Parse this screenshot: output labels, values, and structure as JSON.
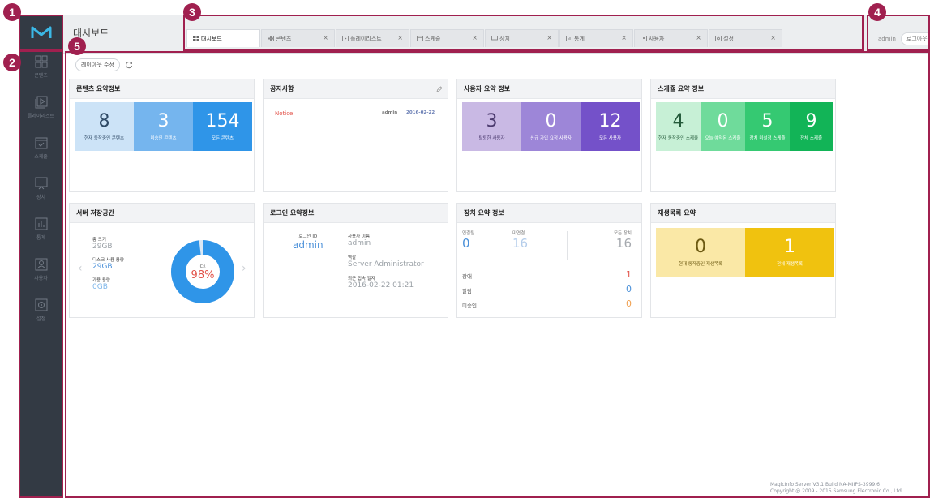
{
  "colors": {
    "sidebar_bg": "#333a44",
    "accent": "#a0204f",
    "blue": "#4a90d9",
    "red": "#e2534a",
    "orange": "#f0a050"
  },
  "badges": [
    "1",
    "2",
    "3",
    "4",
    "5"
  ],
  "sidebar": {
    "logo_icon": "magicinfo-logo-icon",
    "items": [
      {
        "label": "콘텐츠",
        "icon": "content-grid-icon"
      },
      {
        "label": "플레이리스트",
        "icon": "playlist-icon"
      },
      {
        "label": "스케쥴",
        "icon": "schedule-calendar-icon"
      },
      {
        "label": "장치",
        "icon": "device-monitor-icon"
      },
      {
        "label": "통계",
        "icon": "statistics-chart-icon"
      },
      {
        "label": "사용자",
        "icon": "user-icon"
      },
      {
        "label": "설정",
        "icon": "settings-gear-icon"
      }
    ]
  },
  "header": {
    "page_title": "대시보드",
    "tabs": [
      {
        "label": "대시보드",
        "active": true
      },
      {
        "label": "콘텐츠",
        "active": false
      },
      {
        "label": "플레이리스트",
        "active": false
      },
      {
        "label": "스케쥴",
        "active": false
      },
      {
        "label": "장치",
        "active": false
      },
      {
        "label": "통계",
        "active": false
      },
      {
        "label": "사용자",
        "active": false
      },
      {
        "label": "설정",
        "active": false
      }
    ],
    "tab_close": "×",
    "user": "admin",
    "logout": "로그아웃"
  },
  "toolbar": {
    "layout_edit": "레이아웃 수정"
  },
  "widgets": {
    "content": {
      "title": "콘텐츠 요약정보",
      "stats": [
        {
          "value": "8",
          "label": "현재 동작중인 콘텐츠"
        },
        {
          "value": "3",
          "label": "미승인 콘텐츠"
        },
        {
          "value": "154",
          "label": "모든 콘텐츠"
        }
      ]
    },
    "notice": {
      "title": "공지사항",
      "item_title": "Notice",
      "item_author": "admin",
      "item_date": "2016-02-22"
    },
    "user": {
      "title": "사용자 요약 정보",
      "stats": [
        {
          "value": "3",
          "label": "탈퇴한 사용자"
        },
        {
          "value": "0",
          "label": "신규 가입 요청 사용자"
        },
        {
          "value": "12",
          "label": "모든 사용자"
        }
      ]
    },
    "schedule": {
      "title": "스케쥴 요약 정보",
      "stats": [
        {
          "value": "4",
          "label": "현재 동작중인 스케쥴"
        },
        {
          "value": "0",
          "label": "오늘 예약된 스케쥴"
        },
        {
          "value": "5",
          "label": "장치 미설정 스케쥴"
        },
        {
          "value": "9",
          "label": "전체 스케쥴"
        }
      ]
    },
    "storage": {
      "title": "서버 저장공간",
      "total_label": "총 크기",
      "total_value": "29GB",
      "used_label": "디스크 사용 용량",
      "used_value": "29GB",
      "free_label": "가용 용량",
      "free_value": "0GB",
      "drive": "C:\\",
      "percent": "98%",
      "percent_value": 98
    },
    "login": {
      "title": "로그인 요약정보",
      "id_label": "로그인 ID",
      "id_value": "admin",
      "name_label": "사용자 이름",
      "name_value": "admin",
      "role_label": "역할",
      "role_value": "Server Administrator",
      "last_label": "최근 접속 일자",
      "last_value": "2016-02-22 01:21"
    },
    "device": {
      "title": "장치 요약 정보",
      "connected_label": "연결됨",
      "connected_value": "0",
      "disconnected_label": "미연결",
      "disconnected_value": "16",
      "all_label": "모든 장치",
      "all_value": "16",
      "rows": [
        {
          "label": "장애",
          "value": "1"
        },
        {
          "label": "알람",
          "value": "0"
        },
        {
          "label": "미승인",
          "value": "0"
        }
      ]
    },
    "playlist": {
      "title": "재생목록 요약",
      "stats": [
        {
          "value": "0",
          "label": "현재 동작중인 재생목록"
        },
        {
          "value": "1",
          "label": "전체 재생목록"
        }
      ]
    }
  },
  "footer": {
    "build": "MagicInfo Server V3.1 Build NA-MIIPS-3999.6",
    "copyright": "Copyright @ 2009 - 2015 Samsung Electronic Co., Ltd."
  }
}
